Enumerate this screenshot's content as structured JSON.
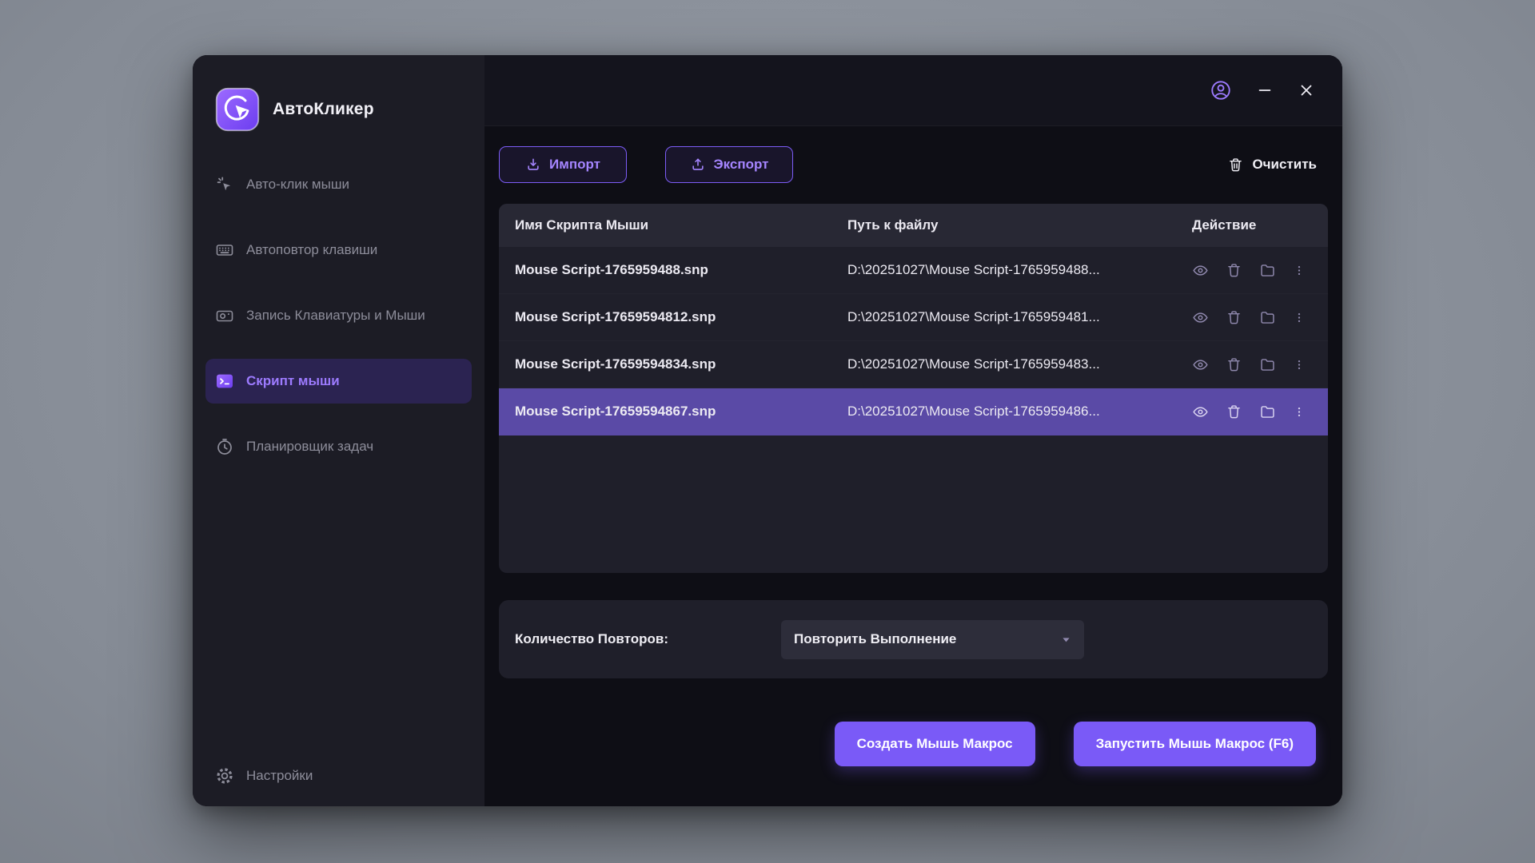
{
  "app": {
    "title": "АвтоКликер"
  },
  "colors": {
    "accent": "#7c5cf6",
    "accent_light": "#9d7bff",
    "selected_row": "#5a4aa6",
    "primary_button": "#7a5af7",
    "sidebar_bg": "#1c1c25",
    "panel_bg": "#1f1f2a"
  },
  "icons": {
    "logo": "cursor-click-badge",
    "sidebar": [
      "auto-click-cursor",
      "keyboard",
      "recorder-camera",
      "terminal-script",
      "clock-scheduler",
      "gear"
    ],
    "topbar": [
      "account-person",
      "minimize-dash",
      "close-x"
    ],
    "toolbar": [
      "download-arrow",
      "upload-arrow",
      "trash"
    ],
    "row_actions": [
      "eye",
      "trash",
      "folder",
      "kebab-dots"
    ],
    "dropdown": "caret-down"
  },
  "sidebar": {
    "items": [
      {
        "label": "Авто-клик мыши",
        "active": false
      },
      {
        "label": "Автоповтор клавиши",
        "active": false
      },
      {
        "label": "Запись Клавиатуры и Мыши",
        "active": false
      },
      {
        "label": "Скрипт мыши",
        "active": true
      },
      {
        "label": "Планировщик задач",
        "active": false
      }
    ],
    "settings_label": "Настройки"
  },
  "toolbar": {
    "import_label": "Импорт",
    "export_label": "Экспорт",
    "clear_label": "Очистить"
  },
  "table": {
    "columns": [
      "Имя Скрипта Мыши",
      "Путь к файлу",
      "Действие"
    ],
    "selected_index": 3,
    "rows": [
      {
        "name": "Mouse Script-1765959488.snp",
        "path": "D:\\20251027\\Mouse Script-1765959488..."
      },
      {
        "name": "Mouse Script-17659594812.snp",
        "path": "D:\\20251027\\Mouse Script-1765959481..."
      },
      {
        "name": "Mouse Script-17659594834.snp",
        "path": "D:\\20251027\\Mouse Script-1765959483..."
      },
      {
        "name": "Mouse Script-17659594867.snp",
        "path": "D:\\20251027\\Mouse Script-1765959486..."
      }
    ]
  },
  "repeat": {
    "label": "Количество Повторов:",
    "value": "Повторить Выполнение"
  },
  "footer": {
    "create_label": "Создать Мышь Макрос",
    "run_label": "Запустить Мышь Макрос (F6)"
  }
}
